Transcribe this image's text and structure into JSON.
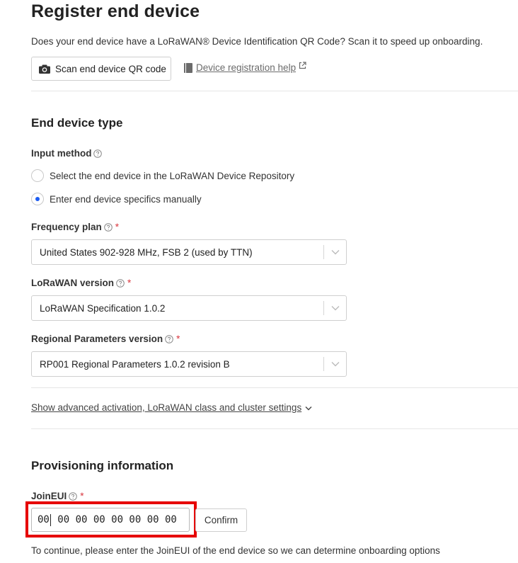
{
  "page": {
    "title": "Register end device",
    "intro": "Does your end device have a LoRaWAN® Device Identification QR Code? Scan it to speed up onboarding.",
    "qr_button": "Scan end device QR code",
    "help_link": "Device registration help"
  },
  "end_device_type": {
    "title": "End device type",
    "input_method_label": "Input method",
    "options": [
      {
        "label": "Select the end device in the LoRaWAN Device Repository",
        "selected": false
      },
      {
        "label": "Enter end device specifics manually",
        "selected": true
      }
    ],
    "frequency_plan": {
      "label": "Frequency plan",
      "required": "*",
      "value": "United States 902-928 MHz, FSB 2 (used by TTN)"
    },
    "lorawan_version": {
      "label": "LoRaWAN version",
      "required": "*",
      "value": "LoRaWAN Specification 1.0.2"
    },
    "regional_parameters": {
      "label": "Regional Parameters version",
      "required": "*",
      "value": "RP001 Regional Parameters 1.0.2 revision B"
    },
    "advanced_link": "Show advanced activation, LoRaWAN class and cluster settings"
  },
  "provisioning": {
    "title": "Provisioning information",
    "joineui_label": "JoinEUI",
    "required": "*",
    "joineui_value_before_caret": "00",
    "joineui_value_after_caret": " 00 00 00 00 00 00 00",
    "confirm_button": "Confirm",
    "note": "To continue, please enter the JoinEUI of the end device so we can determine onboarding options"
  },
  "colors": {
    "accent": "#1c5cf2",
    "required": "#d9363e",
    "highlight_frame": "#e60000"
  },
  "icons": [
    "camera-icon",
    "book-icon",
    "external-link-icon",
    "help-circle-icon",
    "chevron-down-icon"
  ]
}
